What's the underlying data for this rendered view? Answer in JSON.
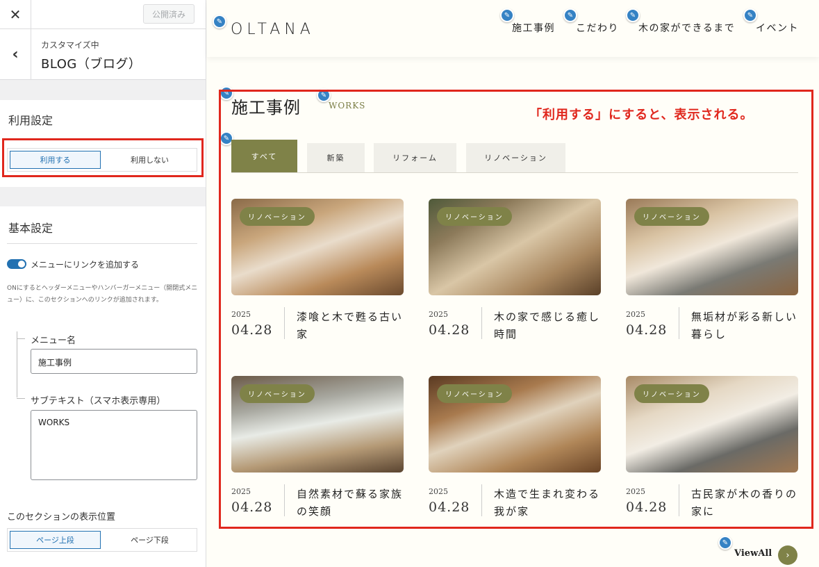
{
  "customizer": {
    "close_icon": "close-icon",
    "publish_label": "公開済み",
    "back_icon": "chevron-left-icon",
    "subheading": "カスタマイズ中",
    "title": "BLOG（ブログ）",
    "usage": {
      "heading": "利用設定",
      "on_label": "利用する",
      "off_label": "利用しない",
      "selected": "利用する"
    },
    "basic": {
      "heading": "基本設定",
      "toggle_label": "メニューにリンクを追加する",
      "toggle_on": true,
      "description": "ONにするとヘッダーメニューやハンバーガーメニュー（開閉式メニュー）に、このセクションへのリンクが追加されます。",
      "menu_name_label": "メニュー名",
      "menu_name_value": "施工事例",
      "subtext_label": "サブテキスト（スマホ表示専用）",
      "subtext_value": "WORKS",
      "position_label": "このセクションの表示位置",
      "position_top": "ページ上段",
      "position_bottom": "ページ下段"
    }
  },
  "preview": {
    "logo": "OLTANA",
    "nav": [
      "施工事例",
      "こだわり",
      "木の家ができるまで",
      "イベント"
    ],
    "section_title": "施工事例",
    "section_sub": "WORKS",
    "annotation": "「利用する」にすると、表示される。",
    "tabs": [
      "すべて",
      "新築",
      "リフォーム",
      "リノベーション"
    ],
    "cards": [
      {
        "badge": "リノベーション",
        "year": "2025",
        "date": "04.28",
        "title": "漆喰と木で甦る古い家"
      },
      {
        "badge": "リノベーション",
        "year": "2025",
        "date": "04.28",
        "title": "木の家で感じる癒し時間"
      },
      {
        "badge": "リノベーション",
        "year": "2025",
        "date": "04.28",
        "title": "無垢材が彩る新しい暮らし"
      },
      {
        "badge": "リノベーション",
        "year": "2025",
        "date": "04.28",
        "title": "自然素材で蘇る家族の笑顔"
      },
      {
        "badge": "リノベーション",
        "year": "2025",
        "date": "04.28",
        "title": "木造で生まれ変わる我が家"
      },
      {
        "badge": "リノベーション",
        "year": "2025",
        "date": "04.28",
        "title": "古民家が木の香りの家に"
      }
    ],
    "viewall": "ViewAll",
    "colors": {
      "accent": "#7f8248",
      "highlight": "#e0271d",
      "wp_blue": "#2271b1"
    }
  }
}
